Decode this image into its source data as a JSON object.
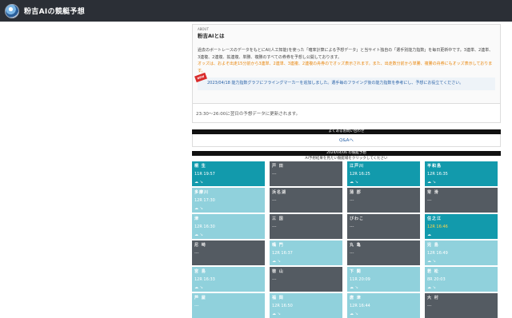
{
  "app": {
    "title": "粉吉AIの競艇予想"
  },
  "intro": {
    "kicker": "ABOUT",
    "heading": "粉吉AIとは",
    "body": "過去のボートレースのデータをもとにAI(人工知能)を使った「確率計算による予想データ」と当サイト独自の「選手別能力指数」を毎日更新中です。3連単、2連単、3連複、2連複、拡連複、単勝、複勝のすべての券券を予想し公開しております。",
    "odds_note": "オッズは、およそ出走15分前から3連単、2連単、3連複、2連複の舟券のでオッズ表示されます。また、出走数分前から単勝、複勝の舟券にもオッズ表示しております。",
    "news_badge": "NEW",
    "news_text": "2023/04/18 能力指数グラフにフライングマーカーを追加しました。選手毎のフライング後の能力指数を参考にし、予想にお役立てください。"
  },
  "update_note": "23:30〜26:00に翌日の予想データに更新されます。",
  "faq": {
    "bar": "よくあるお問い合わせ",
    "link": "Q&Aへ"
  },
  "schedule": {
    "bar": "2024/04/06 の競艇予想",
    "sub": "AI予想結果を見たい競艇場をクリックしてください"
  },
  "venues": [
    {
      "name": "桐 生",
      "race": "11R 19:57",
      "tone": "teal",
      "icons": "☁ ↘"
    },
    {
      "name": "戸 田",
      "race": "---",
      "tone": "dark",
      "icons": ""
    },
    {
      "name": "江戸川",
      "race": "12R 16:25",
      "tone": "teal",
      "icons": "☁ ↘"
    },
    {
      "name": "平和島",
      "race": "12R 16:35",
      "tone": "teal",
      "icons": "☁ ↘"
    },
    {
      "name": "多摩川",
      "race": "12R 17:30",
      "tone": "light",
      "icons": "☁ ↘"
    },
    {
      "name": "浜名湖",
      "race": "---",
      "tone": "dark",
      "icons": ""
    },
    {
      "name": "蒲 郡",
      "race": "---",
      "tone": "dark",
      "icons": ""
    },
    {
      "name": "常 滑",
      "race": "---",
      "tone": "dark",
      "icons": ""
    },
    {
      "name": "津",
      "race": "12R 16:30",
      "tone": "light",
      "icons": "☁ ↘"
    },
    {
      "name": "三 国",
      "race": "---",
      "tone": "dark",
      "icons": ""
    },
    {
      "name": "びわこ",
      "race": "---",
      "tone": "dark",
      "icons": ""
    },
    {
      "name": "住之江",
      "race": "12R 16:46",
      "tone": "teal",
      "icons": "☁",
      "highlight": true
    },
    {
      "name": "尼 崎",
      "race": "---",
      "tone": "dark",
      "icons": ""
    },
    {
      "name": "鳴 門",
      "race": "12R 16:37",
      "tone": "light",
      "icons": "☁ ↘"
    },
    {
      "name": "丸 亀",
      "race": "---",
      "tone": "dark",
      "icons": ""
    },
    {
      "name": "児 島",
      "race": "12R 16:49",
      "tone": "light",
      "icons": "☁ ↘"
    },
    {
      "name": "宮 島",
      "race": "12R 16:33",
      "tone": "light",
      "icons": "☁ ↘"
    },
    {
      "name": "徳 山",
      "race": "---",
      "tone": "dark",
      "icons": ""
    },
    {
      "name": "下 関",
      "race": "11R 20:09",
      "tone": "light",
      "icons": "☁ ↘"
    },
    {
      "name": "若 松",
      "race": "8R 20:03",
      "tone": "light",
      "icons": "☁ ↘"
    },
    {
      "name": "芦 屋",
      "race": "---",
      "tone": "light",
      "icons": ""
    },
    {
      "name": "福 岡",
      "race": "12R 16:50",
      "tone": "light",
      "icons": "☁ ↘"
    },
    {
      "name": "唐 津",
      "race": "12R 16:44",
      "tone": "light",
      "icons": "☁ ↘"
    },
    {
      "name": "大 村",
      "race": "---",
      "tone": "dark",
      "icons": ""
    }
  ]
}
